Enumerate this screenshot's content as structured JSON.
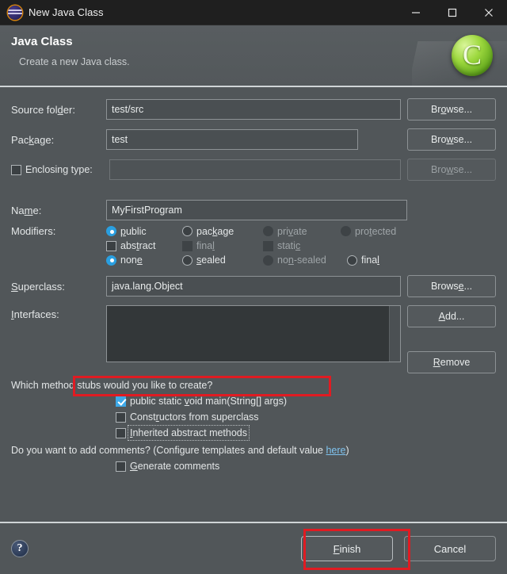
{
  "window": {
    "title": "New Java Class",
    "icon": "eclipse-icon",
    "controls": {
      "minimize": "minimize-icon",
      "maximize": "maximize-icon",
      "close": "close-icon"
    }
  },
  "banner": {
    "title": "Java Class",
    "subtitle": "Create a new Java class.",
    "badge_letter": "C"
  },
  "form": {
    "source_folder": {
      "label_a": "Source fol",
      "label_mn": "d",
      "label_b": "er:",
      "value": "test/src",
      "button": "Browse...",
      "button_mn": "o"
    },
    "package": {
      "label_a": "Pac",
      "label_mn": "k",
      "label_b": "age:",
      "value": "test",
      "button": "Browse...",
      "button_mn": "w"
    },
    "enclosing_type": {
      "label": "Enclosing type:",
      "value": "",
      "checked": false,
      "button": "Browse...",
      "button_mn": "w",
      "disabled": true
    },
    "name": {
      "label_a": "Na",
      "label_mn": "m",
      "label_b": "e:",
      "value": "MyFirstProgram"
    },
    "modifiers": {
      "label": "Modifiers:",
      "access": [
        {
          "label_a": "",
          "label_mn": "p",
          "label_b": "ublic",
          "selected": true,
          "disabled": false
        },
        {
          "label_a": "pac",
          "label_mn": "k",
          "label_b": "age",
          "selected": false,
          "disabled": false
        },
        {
          "label_a": "pri",
          "label_mn": "v",
          "label_b": "ate",
          "selected": false,
          "disabled": true
        },
        {
          "label_a": "pro",
          "label_mn": "t",
          "label_b": "ected",
          "selected": false,
          "disabled": true
        }
      ],
      "flags": [
        {
          "label_a": "abs",
          "label_mn": "t",
          "label_b": "ract",
          "checked": false,
          "disabled": false
        },
        {
          "label_a": "fina",
          "label_mn": "l",
          "label_b": "",
          "checked": false,
          "disabled": true
        },
        {
          "label_a": "stati",
          "label_mn": "c",
          "label_b": "",
          "checked": false,
          "disabled": true
        }
      ],
      "sealed": [
        {
          "label_a": "non",
          "label_mn": "e",
          "label_b": "",
          "selected": true,
          "disabled": false
        },
        {
          "label_a": "",
          "label_mn": "s",
          "label_b": "ealed",
          "selected": false,
          "disabled": false
        },
        {
          "label_a": "no",
          "label_mn": "n",
          "label_b": "-sealed",
          "selected": false,
          "disabled": true
        },
        {
          "label_a": "fina",
          "label_mn": "l",
          "label_b": "",
          "selected": false,
          "disabled": false
        }
      ]
    },
    "superclass": {
      "label_a": "",
      "label_mn": "S",
      "label_b": "uperclass:",
      "value": "java.lang.Object",
      "button": "Browse...",
      "button_mn": "e"
    },
    "interfaces": {
      "label_a": "",
      "label_mn": "I",
      "label_b": "nterfaces:",
      "add_button": "Add...",
      "add_mn": "A",
      "remove_button": "Remove",
      "remove_mn": "R",
      "items": []
    }
  },
  "stubs": {
    "question": "Which method stubs would you like to create?",
    "items": [
      {
        "label_a": "public static ",
        "label_mn": "v",
        "label_b": "oid main(String[] args)",
        "checked": true,
        "focused": false,
        "highlighted": true
      },
      {
        "label_a": "Const",
        "label_mn": "r",
        "label_b": "uctors from superclass",
        "checked": false,
        "focused": false,
        "highlighted": false
      },
      {
        "label_a": "",
        "label_mn": "I",
        "label_b": "nherited abstract methods",
        "checked": false,
        "focused": true,
        "highlighted": false
      }
    ]
  },
  "comments": {
    "question_a": "Do you want to add comments? (Configure templates and default value ",
    "link": "here",
    "question_b": ")",
    "checkbox": {
      "label_a": "",
      "label_mn": "G",
      "label_b": "enerate comments",
      "checked": false
    }
  },
  "footer": {
    "help": "?",
    "finish": {
      "label_a": "",
      "label_mn": "F",
      "label_b": "inish",
      "highlighted": true
    },
    "cancel": {
      "label": "Cancel"
    }
  },
  "colors": {
    "dialog_bg": "#515659",
    "titlebar_bg": "#1f1f1f",
    "field_bg": "#4a4f52",
    "listbox_bg": "#333739",
    "accent_blue": "#3ea9e8",
    "radio_blue": "#2a9fe0",
    "link_blue": "#7fc3ef",
    "highlight_red": "#e01b22",
    "badge_green": "#9ed93f"
  }
}
